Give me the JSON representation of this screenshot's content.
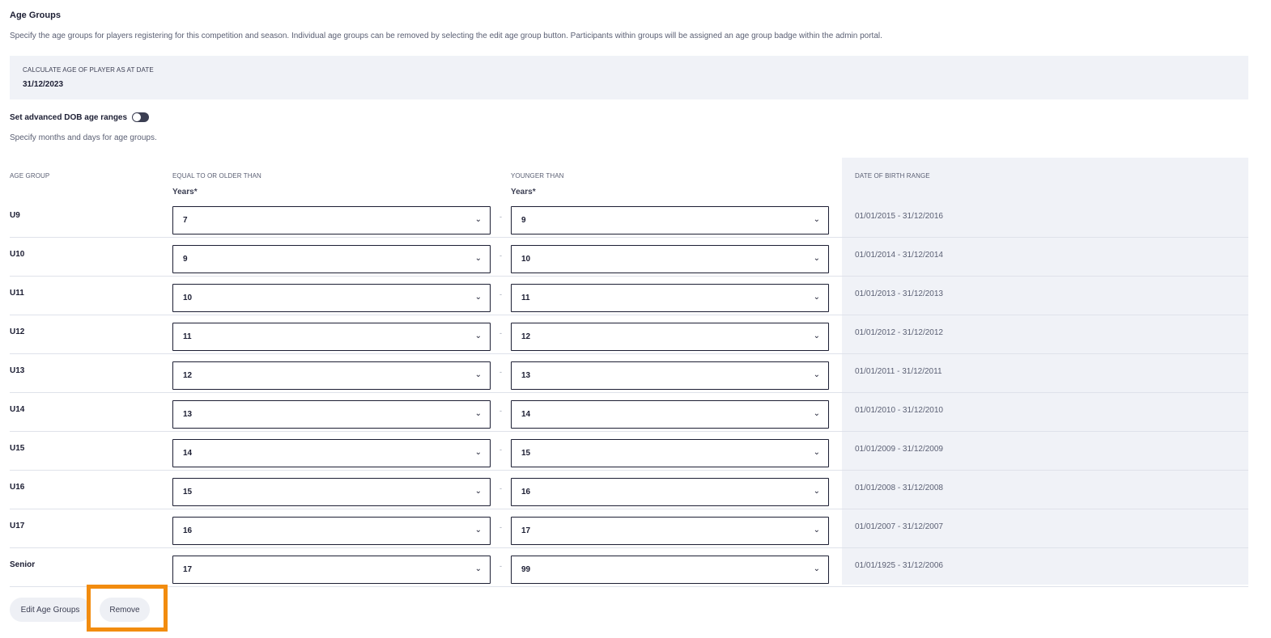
{
  "section": {
    "title": "Age Groups",
    "description": "Specify the age groups for players registering for this competition and season. Individual age groups can be removed by selecting the edit age group button. Participants within groups will be assigned an age group badge within the admin portal."
  },
  "calc": {
    "label": "CALCULATE AGE OF PLAYER AS AT DATE",
    "value": "31/12/2023"
  },
  "advanced": {
    "label": "Set advanced DOB age ranges",
    "description": "Specify months and days for age groups."
  },
  "columns": {
    "age_group": "AGE GROUP",
    "older_than": "EQUAL TO OR OLDER THAN",
    "younger_than": "YOUNGER THAN",
    "dob_range": "DATE OF BIRTH RANGE",
    "years_label": "Years*"
  },
  "rows": [
    {
      "label": "U9",
      "from": "7",
      "to": "9",
      "dob": "01/01/2015 - 31/12/2016"
    },
    {
      "label": "U10",
      "from": "9",
      "to": "10",
      "dob": "01/01/2014 - 31/12/2014"
    },
    {
      "label": "U11",
      "from": "10",
      "to": "11",
      "dob": "01/01/2013 - 31/12/2013"
    },
    {
      "label": "U12",
      "from": "11",
      "to": "12",
      "dob": "01/01/2012 - 31/12/2012"
    },
    {
      "label": "U13",
      "from": "12",
      "to": "13",
      "dob": "01/01/2011 - 31/12/2011"
    },
    {
      "label": "U14",
      "from": "13",
      "to": "14",
      "dob": "01/01/2010 - 31/12/2010"
    },
    {
      "label": "U15",
      "from": "14",
      "to": "15",
      "dob": "01/01/2009 - 31/12/2009"
    },
    {
      "label": "U16",
      "from": "15",
      "to": "16",
      "dob": "01/01/2008 - 31/12/2008"
    },
    {
      "label": "U17",
      "from": "16",
      "to": "17",
      "dob": "01/01/2007 - 31/12/2007"
    },
    {
      "label": "Senior",
      "from": "17",
      "to": "99",
      "dob": "01/01/1925 - 31/12/2006"
    }
  ],
  "range_separator": "-",
  "chevron_glyph": "⌄",
  "icons": {
    "select_chevron": "chevron-down-icon"
  },
  "actions": {
    "edit_label": "Edit Age Groups",
    "remove_label": "Remove"
  },
  "colors": {
    "highlight": "#f28c0f",
    "panel": "#f0f2f7",
    "text_dark": "#1c1e33"
  }
}
